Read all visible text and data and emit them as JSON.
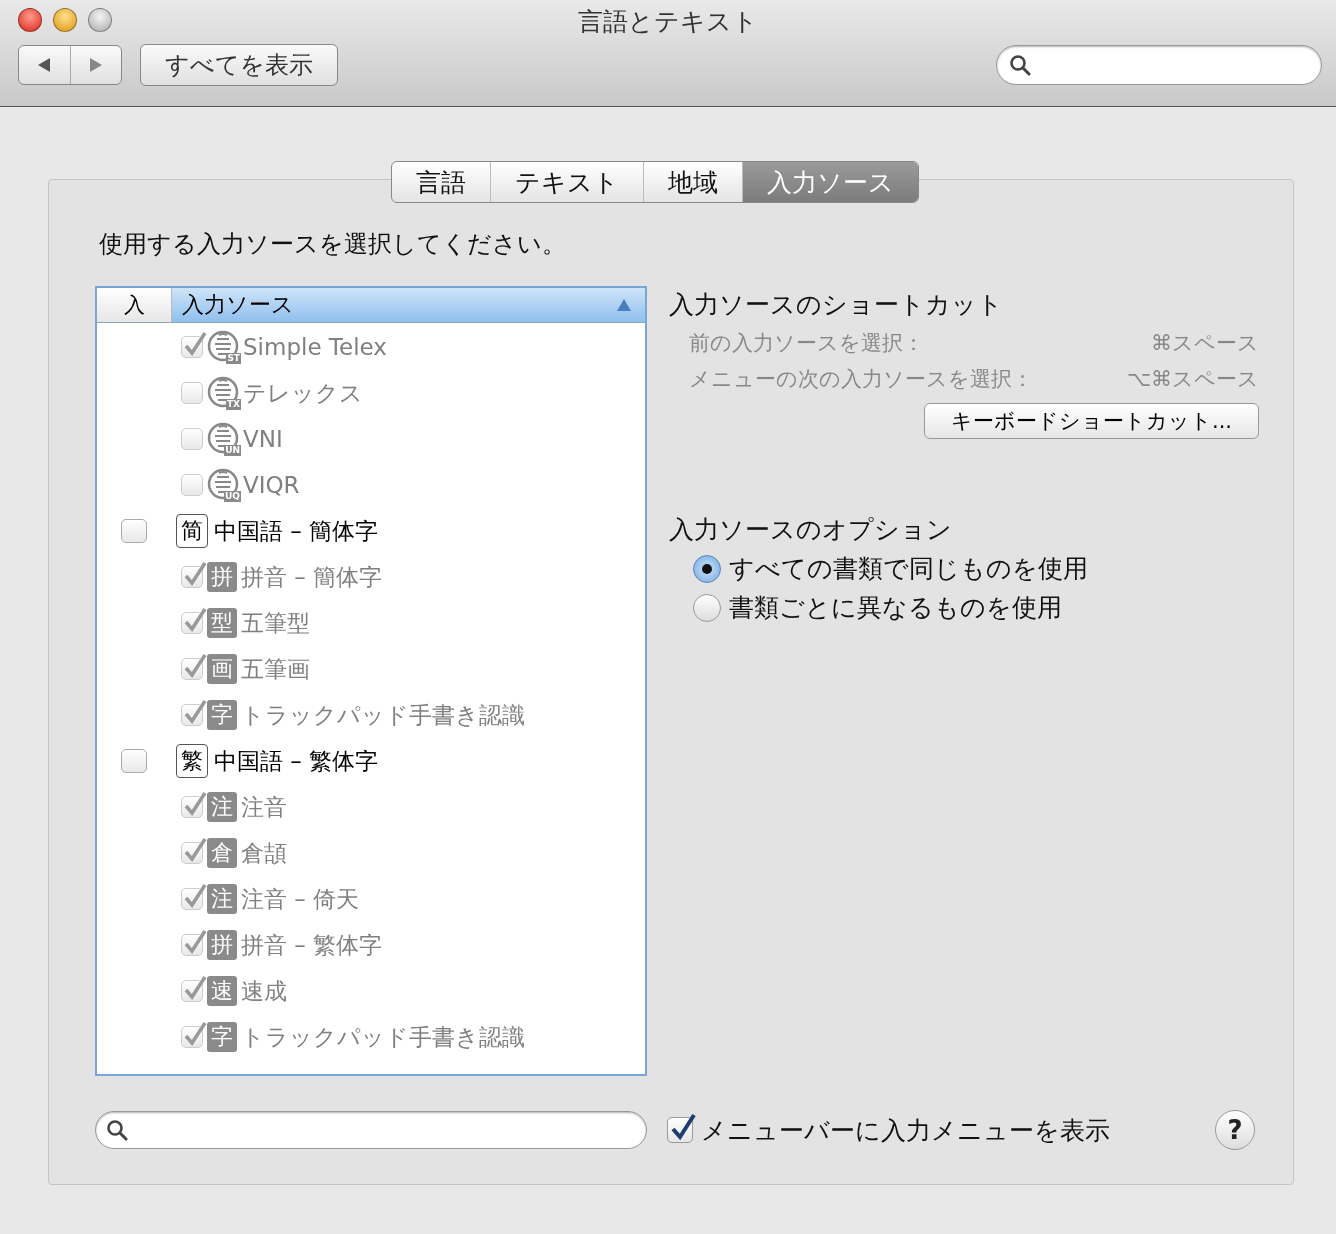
{
  "window": {
    "title": "言語とテキスト",
    "show_all_button": "すべてを表示"
  },
  "tabs": [
    {
      "label": "言語",
      "selected": false
    },
    {
      "label": "テキスト",
      "selected": false
    },
    {
      "label": "地域",
      "selected": false
    },
    {
      "label": "入力ソース",
      "selected": true
    }
  ],
  "instruction": "使用する入力ソースを選択してください。",
  "source_list": {
    "columns": [
      "入",
      "入力ソース"
    ],
    "rows": [
      {
        "kind": "vietnamese",
        "label": "Simple Telex",
        "badge": "ST",
        "checked": true,
        "disabled": true
      },
      {
        "kind": "vietnamese",
        "label": "テレックス",
        "badge": "TX",
        "checked": false,
        "disabled": true
      },
      {
        "kind": "vietnamese",
        "label": "VNI",
        "badge": "UN",
        "checked": false,
        "disabled": true
      },
      {
        "kind": "vietnamese",
        "label": "VIQR",
        "badge": "UQ",
        "checked": false,
        "disabled": true
      },
      {
        "kind": "language",
        "label": "中国語 – 簡体字",
        "glyph": "简",
        "checked": false,
        "disabled": false,
        "children": [
          {
            "kind": "hanzi",
            "label": "拼音 – 簡体字",
            "glyph": "拼",
            "checked": true,
            "disabled": true
          },
          {
            "kind": "hanzi",
            "label": "五筆型",
            "glyph": "型",
            "checked": true,
            "disabled": true
          },
          {
            "kind": "hanzi",
            "label": "五筆画",
            "glyph": "画",
            "checked": true,
            "disabled": true
          },
          {
            "kind": "hanzi",
            "label": "トラックパッド手書き認識",
            "glyph": "字",
            "checked": true,
            "disabled": true
          }
        ]
      },
      {
        "kind": "language",
        "label": "中国語 – 繁体字",
        "glyph": "繁",
        "checked": false,
        "disabled": false,
        "children": [
          {
            "kind": "hanzi",
            "label": "注音",
            "glyph": "注",
            "checked": true,
            "disabled": true
          },
          {
            "kind": "hanzi",
            "label": "倉頡",
            "glyph": "倉",
            "checked": true,
            "disabled": true
          },
          {
            "kind": "hanzi",
            "label": "注音 – 倚天",
            "glyph": "注",
            "checked": true,
            "disabled": true
          },
          {
            "kind": "hanzi",
            "label": "拼音 – 繁体字",
            "glyph": "拼",
            "checked": true,
            "disabled": true
          },
          {
            "kind": "hanzi",
            "label": "速成",
            "glyph": "速",
            "checked": true,
            "disabled": true
          },
          {
            "kind": "hanzi",
            "label": "トラックパッド手書き認識",
            "glyph": "字",
            "checked": true,
            "disabled": true
          }
        ]
      }
    ]
  },
  "shortcuts": {
    "title": "入力ソースのショートカット",
    "items": [
      {
        "label": "前の入力ソースを選択：",
        "keys": "⌘スペース"
      },
      {
        "label": "メニューの次の入力ソースを選択：",
        "keys": "⌥⌘スペース"
      }
    ],
    "button": "キーボードショートカット..."
  },
  "options": {
    "title": "入力ソースのオプション",
    "radios": [
      {
        "label": "すべての書類で同じものを使用",
        "selected": true
      },
      {
        "label": "書類ごとに異なるものを使用",
        "selected": false
      }
    ]
  },
  "show_menu": {
    "label": "メニューバーに入力メニューを表示",
    "checked": true
  },
  "help_button": "?"
}
